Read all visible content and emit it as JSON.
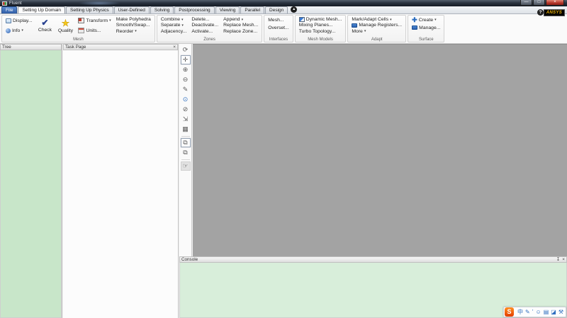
{
  "window": {
    "title": "Fluent",
    "minimize": "—",
    "maximize": "□",
    "close": "×"
  },
  "tabs": [
    {
      "label": "File",
      "active": false
    },
    {
      "label": "Setting Up Domain",
      "active": true
    },
    {
      "label": "Setting Up Physics",
      "active": false
    },
    {
      "label": "User-Defined",
      "active": false
    },
    {
      "label": "Solving",
      "active": false
    },
    {
      "label": "Postprocessing",
      "active": false
    },
    {
      "label": "Viewing",
      "active": false
    },
    {
      "label": "Parallel",
      "active": false
    },
    {
      "label": "Design",
      "active": false
    }
  ],
  "ribbon": {
    "mesh": {
      "label": "Mesh",
      "display": "Display...",
      "info": "Info",
      "check": "Check",
      "quality": "Quality",
      "transform": "Transform",
      "units": "Units...",
      "make_polyhedra": "Make Polyhedra",
      "smooth_swap": "Smooth/Swap...",
      "reorder": "Reorder"
    },
    "zones": {
      "label": "Zones",
      "combine": "Combine",
      "separate": "Separate",
      "adjacency": "Adjacency...",
      "delete": "Delete...",
      "deactivate": "Deactivate...",
      "activate": "Activate...",
      "append": "Append",
      "replace_mesh": "Replace Mesh...",
      "replace_zone": "Replace Zone..."
    },
    "interfaces": {
      "label": "Interfaces",
      "mesh": "Mesh...",
      "overset": "Overset..."
    },
    "mesh_models": {
      "label": "Mesh Models",
      "dynamic_mesh": "Dynamic Mesh...",
      "mixing_planes": "Mixing Planes...",
      "turbo_topology": "Turbo Topology..."
    },
    "adapt": {
      "label": "Adapt",
      "mark_adapt_cells": "Mark/Adapt Cells",
      "manage_registers": "Manage Registers...",
      "more": "More"
    },
    "surface": {
      "label": "Surface",
      "create": "Create",
      "manage": "Manage..."
    },
    "help": "?",
    "logo": "ANSYS"
  },
  "icons": {
    "dropdown": "▾",
    "ribbon_toggle": "▴",
    "check": "✔",
    "star": "★",
    "plus": "✚",
    "pin": "↧",
    "close": "×"
  },
  "panels": {
    "tree": {
      "title": "Tree"
    },
    "task_page": {
      "title": "Task Page"
    },
    "console": {
      "title": "Console"
    }
  },
  "graphics_toolbar": {
    "items": [
      {
        "name": "rotate-view-icon",
        "glyph": "⟳"
      },
      {
        "name": "pan-icon",
        "glyph": "✛"
      },
      {
        "name": "zoom-in-icon",
        "glyph": "⊕"
      },
      {
        "name": "zoom-out-icon",
        "glyph": "⊖"
      },
      {
        "name": "probe-icon",
        "glyph": "✎"
      },
      {
        "name": "zoom-to-selection-icon",
        "glyph": "⊙"
      },
      {
        "name": "zoom-box-icon",
        "glyph": "⊘"
      },
      {
        "name": "fit-to-window-icon",
        "glyph": "⇲"
      },
      {
        "name": "save-picture-icon",
        "glyph": "▦"
      },
      {
        "name": "copy-view-front-icon",
        "glyph": "⧉"
      },
      {
        "name": "copy-view-back-icon",
        "glyph": "⧉"
      },
      {
        "name": "hand-tool-icon",
        "glyph": "☞"
      }
    ]
  },
  "ime_bar": {
    "logo": "S",
    "icons": [
      {
        "name": "ime-mode-icon",
        "glyph": "中"
      },
      {
        "name": "ime-handwriting-icon",
        "glyph": "✎"
      },
      {
        "name": "ime-punctuation-icon",
        "glyph": "’"
      },
      {
        "name": "ime-emoji-icon",
        "glyph": "☺"
      },
      {
        "name": "ime-clipboard-icon",
        "glyph": "▤"
      },
      {
        "name": "ime-skin-icon",
        "glyph": "◪"
      },
      {
        "name": "ime-tools-icon",
        "glyph": "⚒"
      }
    ]
  }
}
